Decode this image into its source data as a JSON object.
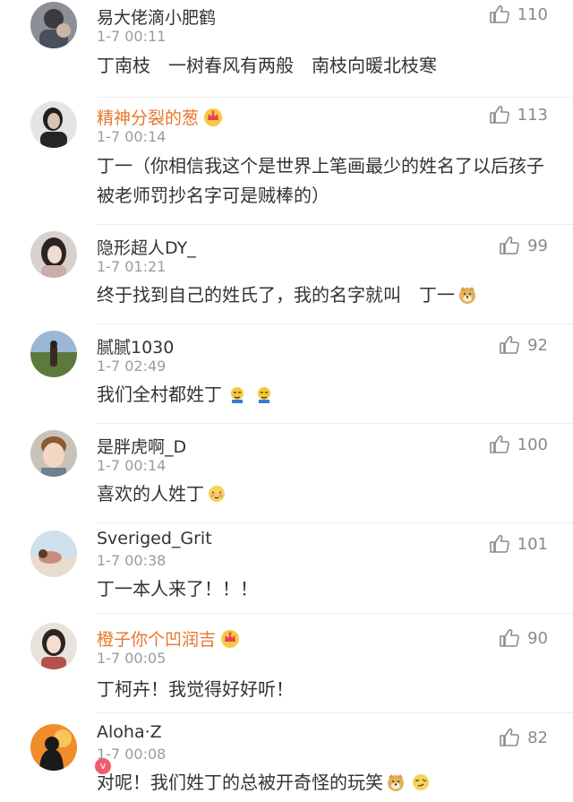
{
  "comments": [
    {
      "user": "易大佬滴小肥鹤",
      "time": "1-7 00:11",
      "text": "丁南枝　一树春风有两般　南枝向暖北枝寒",
      "likes": "110"
    },
    {
      "user": "精神分裂的葱",
      "time": "1-7 00:14",
      "text": "丁一（你相信我这个是世界上笔画最少的姓名了以后孩子被老师罚抄名字可是贼棒的）",
      "likes": "113",
      "vip": true
    },
    {
      "user": "隐形超人DY_",
      "time": "1-7 01:21",
      "text": "终于找到自己的姓氏了，我的名字就叫　丁一",
      "likes": "99",
      "emojis": [
        "doge-emoji"
      ]
    },
    {
      "user": "腻腻1030",
      "time": "1-7 02:49",
      "text": "我们全村都姓丁",
      "likes": "92",
      "emojis": [
        "tears-emoji",
        "tears-emoji"
      ]
    },
    {
      "user": "是胖虎啊_D",
      "time": "1-7 00:14",
      "text": "喜欢的人姓丁",
      "likes": "100",
      "emojis": [
        "shy-emoji"
      ]
    },
    {
      "user": "Sveriged_Grit",
      "time": "1-7 00:38",
      "text": "丁一本人来了！！！",
      "likes": "101"
    },
    {
      "user": "橙子你个凹润吉",
      "time": "1-7 00:05",
      "text": "丁柯卉！我觉得好好听！",
      "likes": "90",
      "vip": true
    },
    {
      "user": "Aloha·Z",
      "time": "1-7 00:08",
      "text": "对呢！我们姓丁的总被开奇怪的玩笑",
      "likes": "82",
      "emojis": [
        "doge-emoji",
        "smirk-emoji"
      ],
      "badge": "v"
    }
  ]
}
